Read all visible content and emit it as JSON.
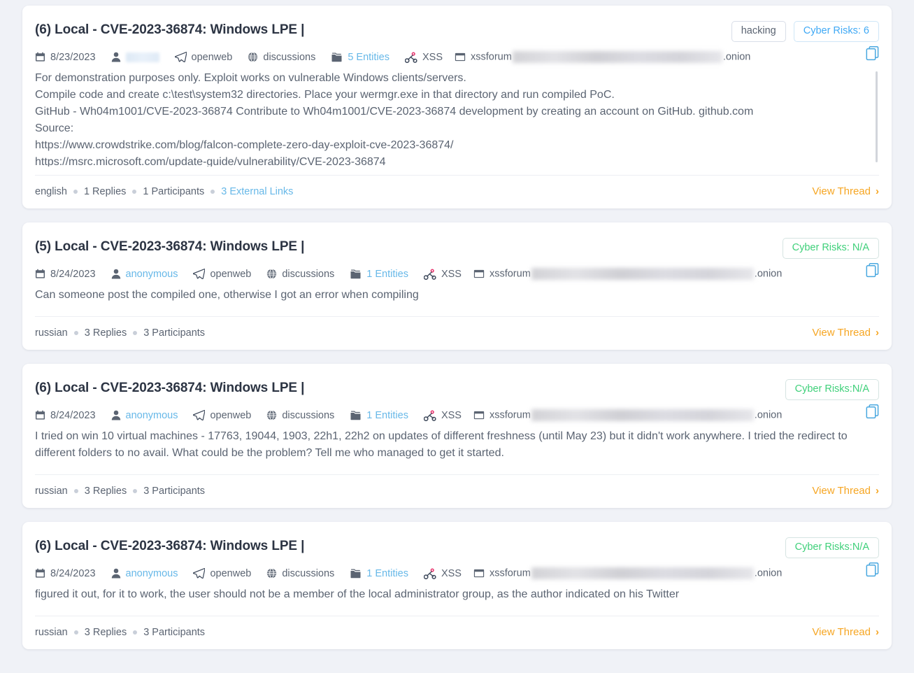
{
  "theme": {
    "page_background": "#f0f2f7",
    "card_background": "#ffffff",
    "title_color": "#2c3443",
    "muted_text": "#5b6472",
    "link_blue": "#67b8e8",
    "accent_orange": "#f6a623",
    "risk_green": "#3fd07a",
    "risk_blue": "#3fa9f5"
  },
  "icons": {
    "calendar": "calendar-icon",
    "user": "user-icon",
    "telegram": "paper-plane-icon",
    "globe": "globe-icon",
    "folder": "folder-icon",
    "bug": "xss-bug-icon",
    "forum": "forum-window-icon",
    "copy": "copy-icon",
    "chevron": "chevron-right-icon"
  },
  "cards": [
    {
      "title": "(6) Local - CVE-2023-36874: Windows LPE |",
      "tag": "hacking",
      "risk_badge": "Cyber Risks: 6",
      "risk_style": "blue",
      "meta": {
        "date": "8/23/2023",
        "author": "",
        "author_redacted": true,
        "source": "openweb",
        "category": "discussions",
        "entities": "5 Entities",
        "forum": "XSS",
        "site_prefix": "xssforum",
        "site_suffix": ".onion",
        "site_redacted_width": 300
      },
      "body": "For demonstration purposes only. Exploit works on vulnerable Windows clients/servers.\nCompile code and create c:\\test\\system32 directories. Place your wermgr.exe in that directory and run compiled PoC.\nGitHub - Wh04m1001/CVE-2023-36874 Contribute to Wh04m1001/CVE-2023-36874 development by creating an account on GitHub. github.com\nSource:\nhttps://www.crowdstrike.com/blog/falcon-complete-zero-day-exploit-cve-2023-36874/\nhttps://msrc.microsoft.com/update-guide/vulnerability/CVE-2023-36874",
      "has_scrollbar": true,
      "footer": {
        "language": "english",
        "replies": "1 Replies",
        "participants": "1 Participants",
        "external_links": "3 External Links",
        "view_thread": "View Thread"
      }
    },
    {
      "title": "(5) Local - CVE-2023-36874: Windows LPE |",
      "tag": "",
      "risk_badge": "Cyber Risks: N/A",
      "risk_style": "green",
      "meta": {
        "date": "8/24/2023",
        "author": "anonymous",
        "author_redacted": false,
        "source": "openweb",
        "category": "discussions",
        "entities": "1 Entities",
        "forum": "XSS",
        "site_prefix": "xssforum",
        "site_suffix": ".onion",
        "site_redacted_width": 318
      },
      "body": "Can someone post the compiled one, otherwise I got an error when compiling",
      "has_scrollbar": false,
      "footer": {
        "language": "russian",
        "replies": "3 Replies",
        "participants": "3 Participants",
        "external_links": "",
        "view_thread": "View Thread"
      }
    },
    {
      "title": "(6) Local - CVE-2023-36874: Windows LPE |",
      "tag": "",
      "risk_badge": "Cyber Risks:N/A",
      "risk_style": "green",
      "meta": {
        "date": "8/24/2023",
        "author": "anonymous",
        "author_redacted": false,
        "source": "openweb",
        "category": "discussions",
        "entities": "1 Entities",
        "forum": "XSS",
        "site_prefix": "xssforum",
        "site_suffix": ".onion",
        "site_redacted_width": 318
      },
      "body": "I tried on win 10 virtual machines - 17763, 19044, 1903, 22h1, 22h2 on updates of different freshness (until May 23) but it didn't work anywhere. I tried the redirect to different folders to no avail. What could be the problem? Tell me who managed to get it started.",
      "has_scrollbar": false,
      "footer": {
        "language": "russian",
        "replies": "3  Replies",
        "participants": "3  Participants",
        "external_links": "",
        "view_thread": "View Thread"
      }
    },
    {
      "title": "(6) Local - CVE-2023-36874: Windows LPE |",
      "tag": "",
      "risk_badge": "Cyber Risks:N/A",
      "risk_style": "green",
      "meta": {
        "date": "8/24/2023",
        "author": "anonymous",
        "author_redacted": false,
        "source": "openweb",
        "category": "discussions",
        "entities": "1 Entities",
        "forum": "XSS",
        "site_prefix": "xssforum",
        "site_suffix": ".onion",
        "site_redacted_width": 318
      },
      "body": "figured it out, for it to work, the user should not be a member of the local administrator group, as the author indicated on his Twitter",
      "has_scrollbar": false,
      "footer": {
        "language": "russian",
        "replies": "3 Replies",
        "participants": "3 Participants",
        "external_links": "",
        "view_thread": "View Thread"
      }
    }
  ]
}
